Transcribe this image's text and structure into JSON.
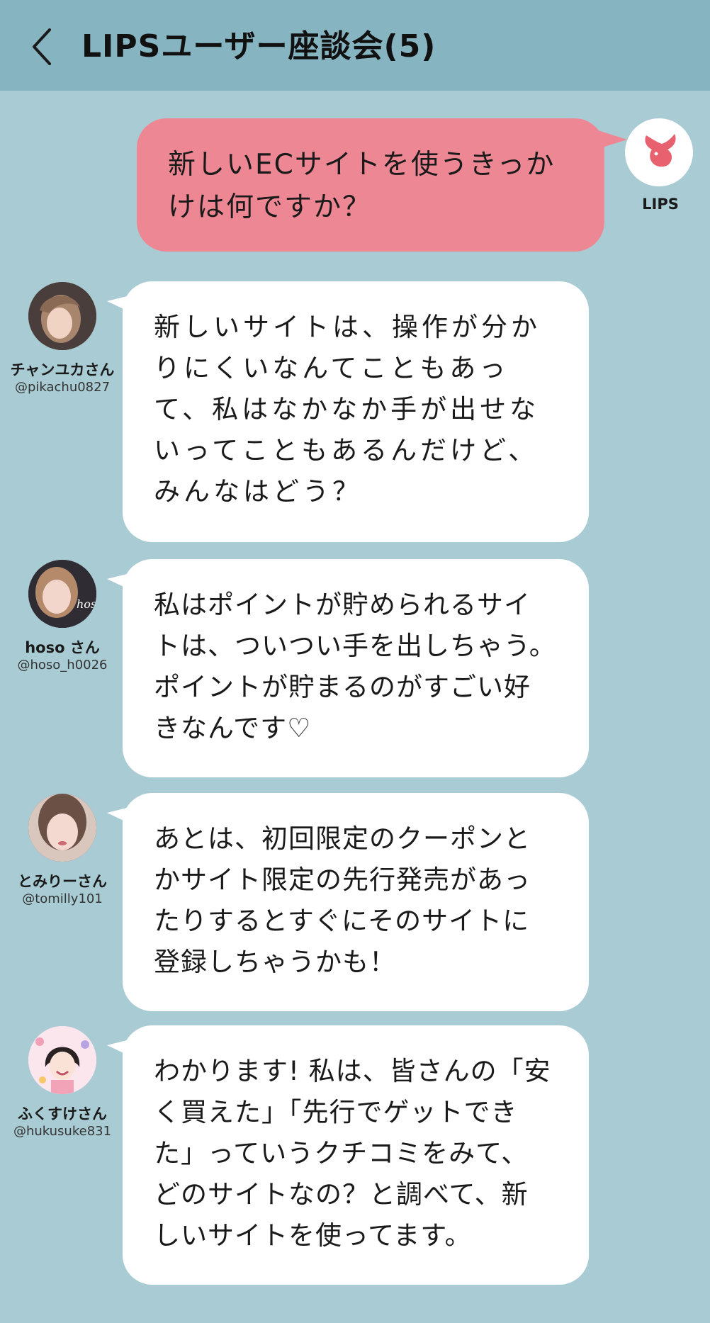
{
  "header": {
    "title": "LIPSユーザー座談会(5)",
    "back_icon": "chevron-left-icon"
  },
  "question": {
    "author": "LIPS",
    "text": "新しいECサイトを使うきっか\nけは何ですか？",
    "bubble_color": "#ee8794",
    "avatar_color": "#e8616f"
  },
  "messages": [
    {
      "name": "チャンユカさん",
      "handle": "@pikachu0827",
      "text": "新しいサイトは、操作が分か\nりにくいなんてこともあっ\nて、私はなかなか手が出せな\nいってこともあるんだけど、\nみんなはどう？"
    },
    {
      "name": "hoso さん",
      "handle": "@hoso_h0026",
      "avatar_text": "hoso",
      "text": "私はポイントが貯められるサイ\nトは、ついつい手を出しちゃう。\nポイントが貯まるのがすごい好\nきなんです♡"
    },
    {
      "name": "とみりーさん",
      "handle": "@tomilly101",
      "text": "あとは、初回限定のクーポンと\nかサイト限定の先行発売があっ\nたりするとすぐにそのサイトに\n登録しちゃうかも！"
    },
    {
      "name": "ふくすけさん",
      "handle": "@hukusuke831",
      "text": "わかります! 私は、皆さんの「安\nく買えた」「先行でゲットでき\nた」っていうクチコミをみて、\nどのサイトなの？と調べて、新\nしいサイトを使ってます。"
    }
  ],
  "colors": {
    "background": "#a9ccd4",
    "header": "#86b4c1",
    "bubble": "#ffffff"
  }
}
